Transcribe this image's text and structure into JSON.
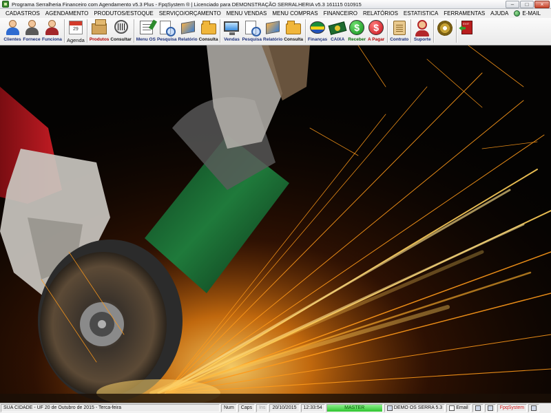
{
  "window": {
    "title": "Programa Serralheria Financeiro com Agendamento v5.3 Plus - FpqSystem ® | Licenciado para  DEMONSTRAÇÃO SERRALHERIA v5.3 161115 010915",
    "buttons": {
      "minimize": "–",
      "maximize": "□",
      "close": "×"
    }
  },
  "menu": {
    "items": [
      "CADASTROS",
      "AGENDAMENTO",
      "PRODUTOS/ESTOQUE",
      "SERVIÇO/ORÇAMENTO",
      "MENU VENDAS",
      "MENU COMPRAS",
      "FINANCEIRO",
      "RELATÓRIOS",
      "ESTATISTICA",
      "FERRAMENTAS",
      "AJUDA"
    ],
    "email": "E-MAIL"
  },
  "toolbar": {
    "clientes": "Clientes",
    "fornece": "Fornece",
    "funciona": "Funciona",
    "agenda": "Agenda",
    "agenda_day": "29",
    "produtos": "Produtos",
    "consultar": "Consultar",
    "menu_os": "Menu OS",
    "pesquisa_os": "Pesquisa",
    "relatorio_os": "Relatório",
    "consulta_os": "Consulta",
    "vendas": "Vendas",
    "pesquisa_vendas": "Pesquisa",
    "relatorio_vendas": "Relatório",
    "consulta_vendas": "Consulta",
    "financas": "Finanças",
    "caixa": "CAIXA",
    "receber": "Receber",
    "receber_symbol": "$",
    "a_pagar": "A Pagar",
    "a_pagar_symbol": "$",
    "contrato": "Contrato",
    "suporte": "Suporte",
    "exit_sign": "EXIT"
  },
  "status": {
    "city": "SUA CIDADE - UF 20 de Outubro de 2015 - Terca-feira",
    "num": "Num",
    "caps": "Caps",
    "ins": "Ins",
    "date": "20/10/2015",
    "time": "12:33:54",
    "master": "MASTER",
    "demo": "DEMO OS SERRA 5.3",
    "email": "Email",
    "brand": "FpqSystem"
  },
  "colors": {
    "toolbar_label": "#1b2f7a",
    "master_green": "#2ec42e",
    "brand_red": "#d21a1a",
    "sparks": "#ff9a1a"
  }
}
